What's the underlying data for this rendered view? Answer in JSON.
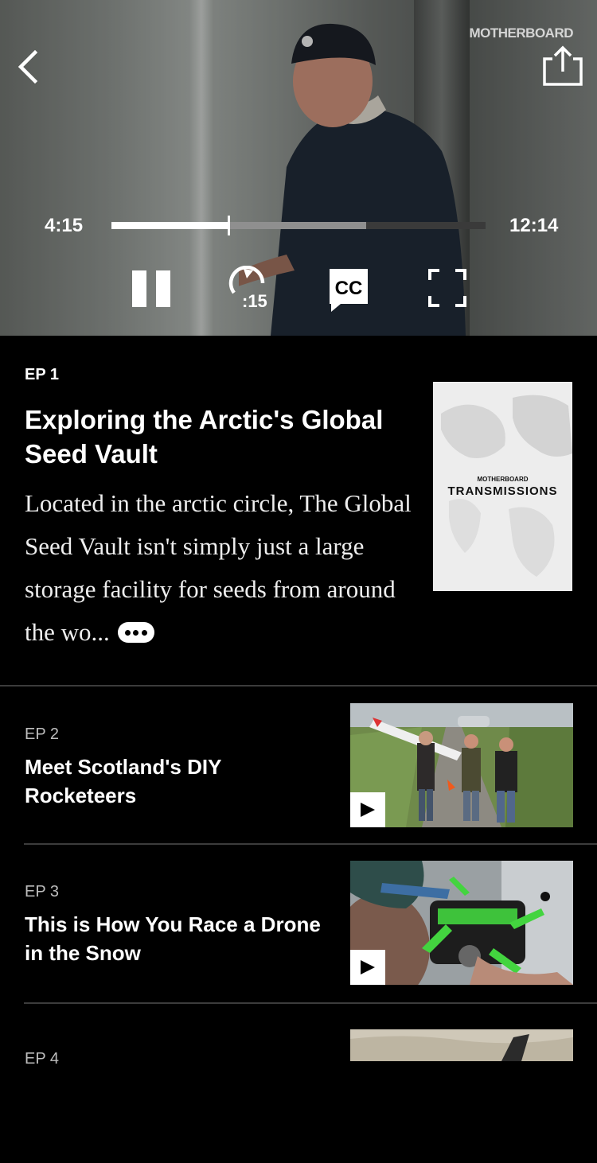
{
  "player": {
    "brand": "MOTHERBOARD",
    "current_time": "4:15",
    "duration": "12:14",
    "progress": 0.313,
    "buffered": 0.68,
    "rewind_label": ":15",
    "cc_label": "CC",
    "controls": [
      "back-icon",
      "share-icon",
      "pause-icon",
      "rewind-15-icon",
      "closed-captions-icon",
      "fullscreen-icon"
    ]
  },
  "current_episode": {
    "number": "EP 1",
    "title": "Exploring the Arctic's Global Seed Vault",
    "description": "Located in the arctic circle, The Global Seed Vault isn't simply just a large storage facility for seeds from around the wo...",
    "poster_brand": "MOTHERBOARD",
    "poster_title": "TRANSMISSIONS"
  },
  "episodes": [
    {
      "number": "EP 2",
      "title": "Meet Scotland's DIY Rocketeers"
    },
    {
      "number": "EP 3",
      "title": "This is How You Race a Drone in the Snow"
    },
    {
      "number": "EP 4",
      "title": ""
    }
  ],
  "colors": {
    "background": "#000000",
    "text": "#ffffff",
    "muted": "#bdbdbd",
    "divider": "#3c3c3c"
  }
}
